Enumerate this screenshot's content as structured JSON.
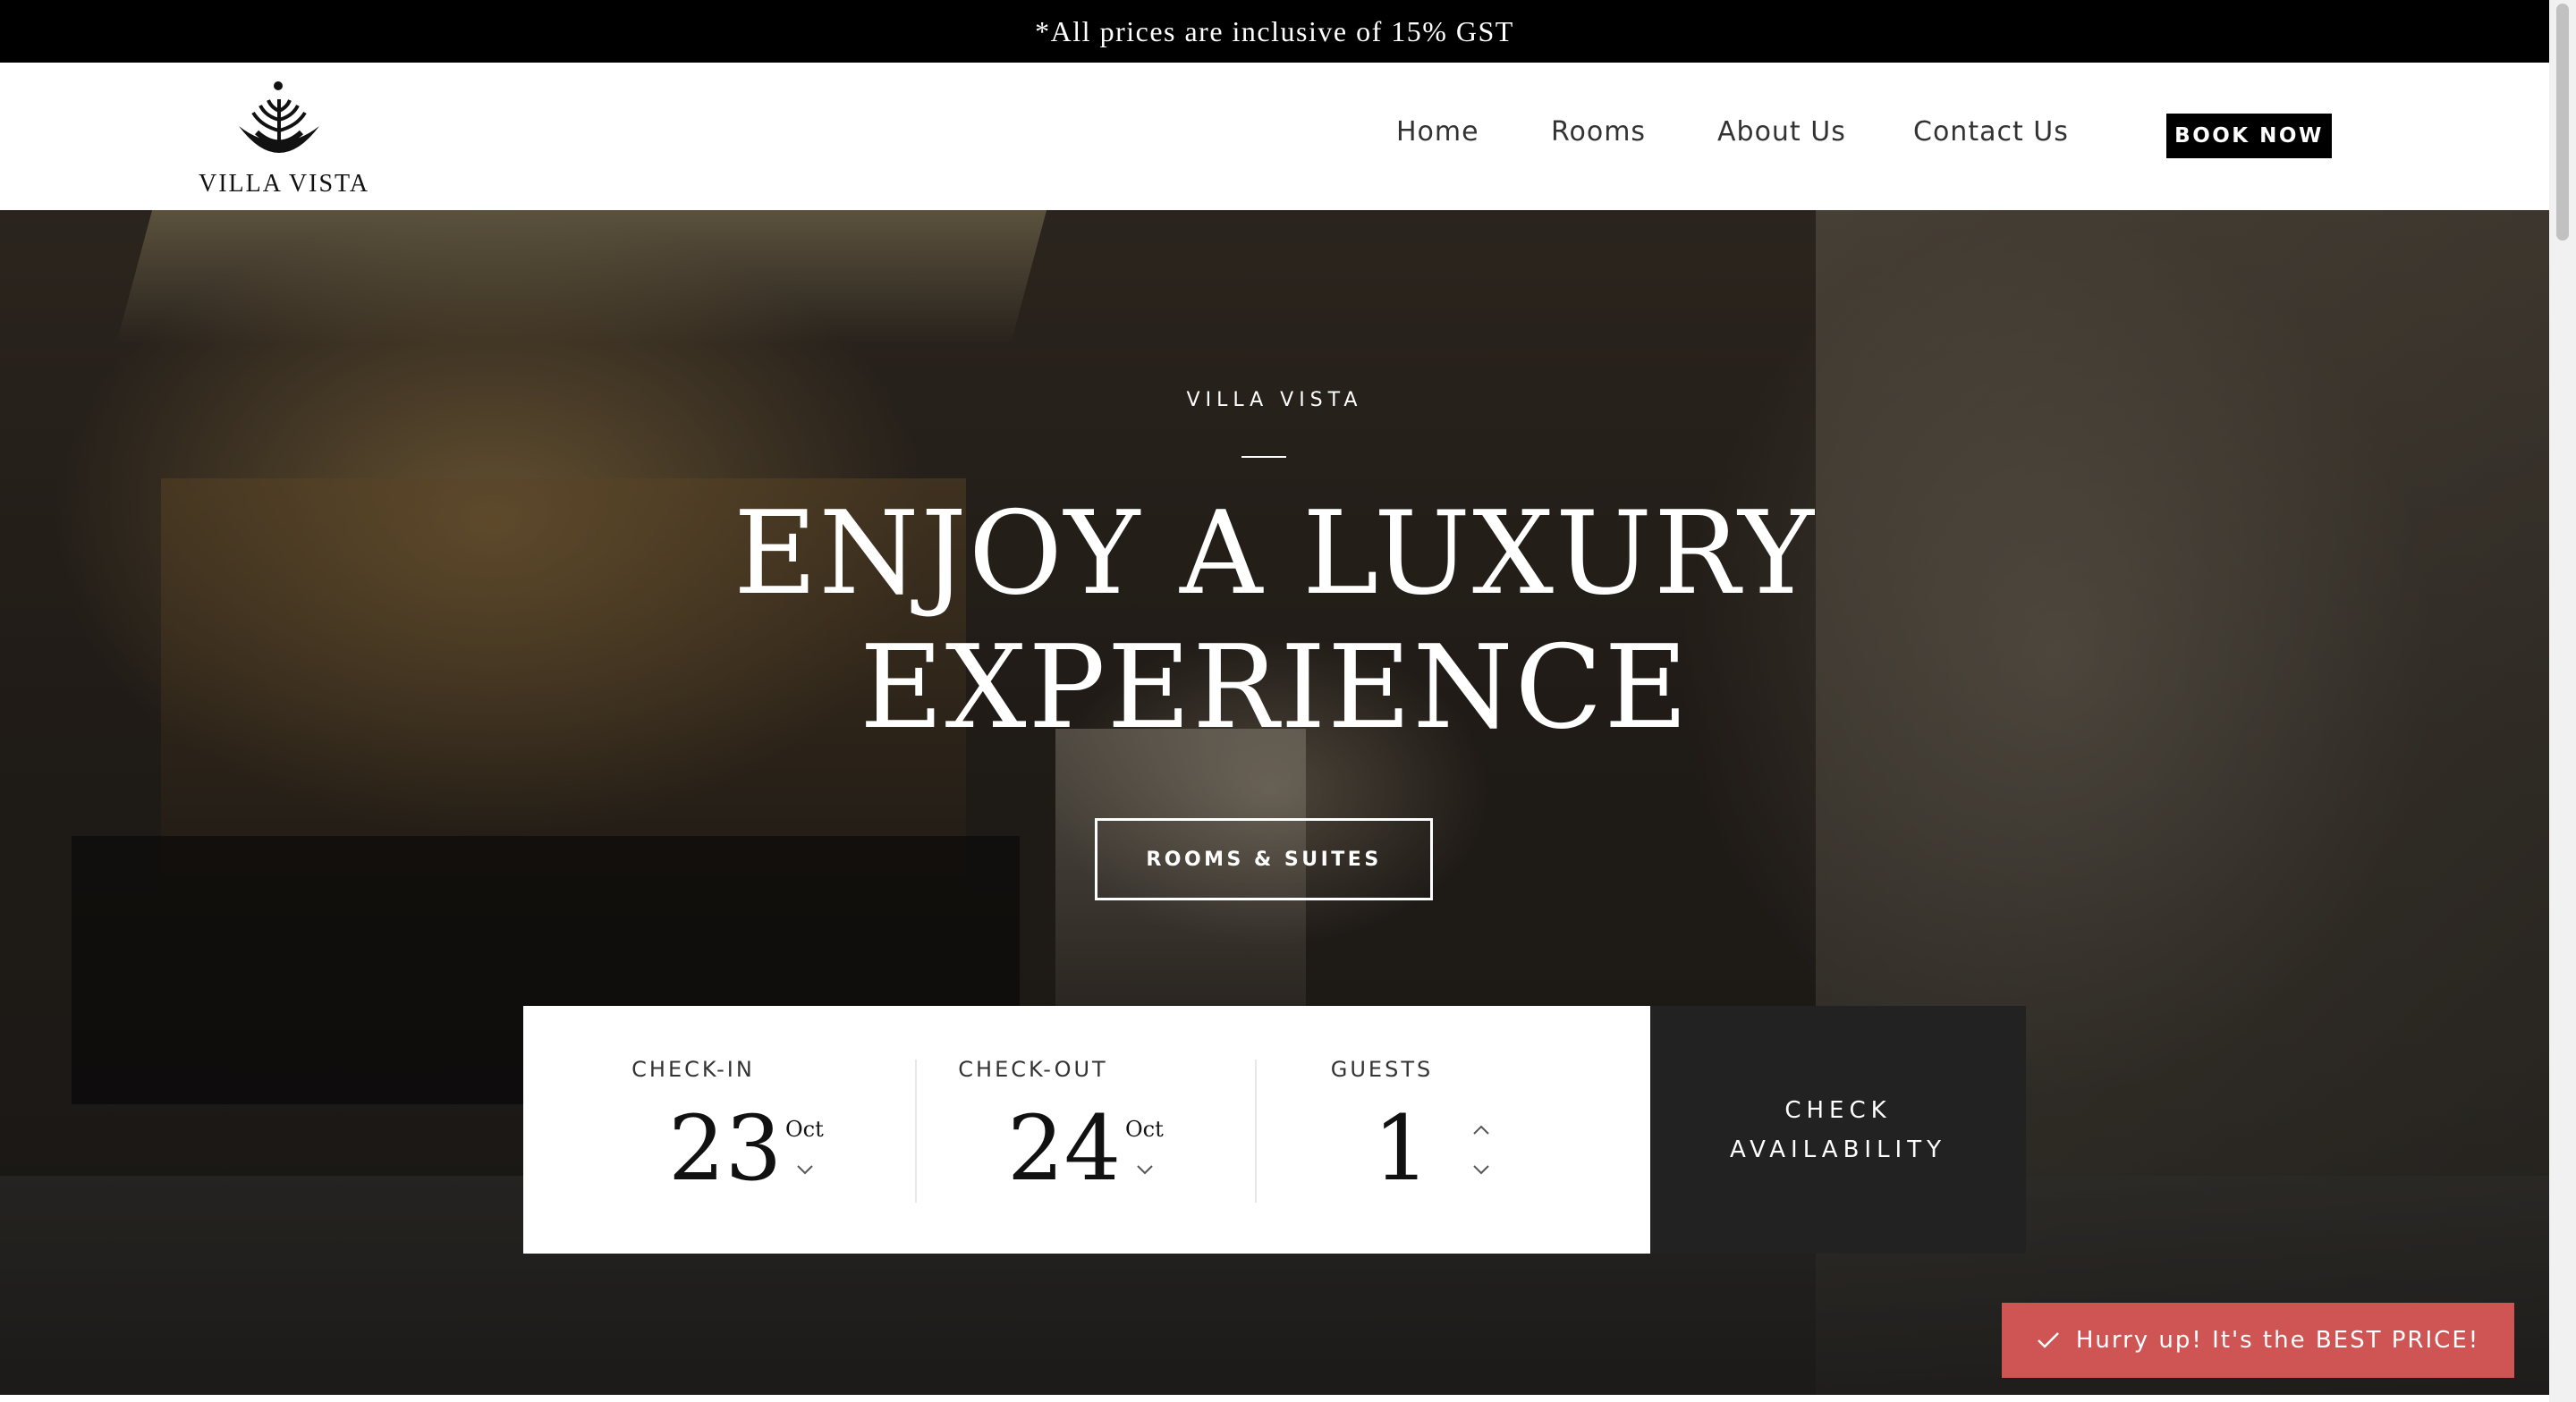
{
  "announcement": {
    "text": "*All prices are inclusive of 15% GST"
  },
  "header": {
    "logo_text": "VILLA VISTA",
    "nav": [
      {
        "label": "Home"
      },
      {
        "label": "Rooms"
      },
      {
        "label": "About Us"
      },
      {
        "label": "Contact Us"
      }
    ],
    "book_now_label": "BOOK NOW"
  },
  "hero": {
    "kicker": "VILLA VISTA",
    "title_line1": "ENJOY A LUXURY",
    "title_line2": "EXPERIENCE",
    "cta_label": "ROOMS & SUITES"
  },
  "booking": {
    "checkin": {
      "label": "CHECK-IN",
      "day": "23",
      "month": "Oct"
    },
    "checkout": {
      "label": "CHECK-OUT",
      "day": "24",
      "month": "Oct"
    },
    "guests": {
      "label": "GUESTS",
      "value": "1"
    },
    "check_line1": "CHECK",
    "check_line2": "AVAILABILITY"
  },
  "promo": {
    "text": "Hurry up! It's the BEST PRICE!",
    "icon": "check-icon"
  },
  "colors": {
    "promo_bg": "#cf5555",
    "topbar_bg": "#000000",
    "check_bg": "#222222"
  }
}
